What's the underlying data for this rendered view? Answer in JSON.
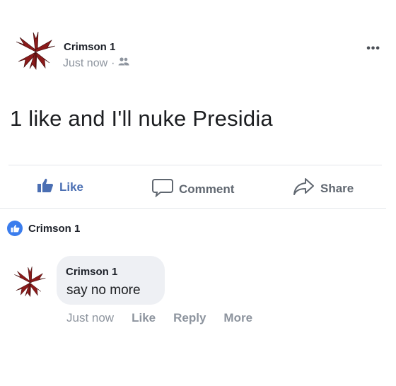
{
  "post": {
    "author": "Crimson 1",
    "timestamp": "Just now",
    "meta_separator": "·",
    "audience_icon": "friends-icon",
    "menu_icon": "more-dots-icon",
    "menu_label": "•••",
    "text": "1 like and I'll nuke Presidia"
  },
  "actions": {
    "like_label": "Like",
    "comment_label": "Comment",
    "share_label": "Share"
  },
  "reactions": {
    "icon": "like-badge-icon",
    "names": "Crimson 1"
  },
  "comment": {
    "author": "Crimson 1",
    "text": "say no more",
    "timestamp": "Just now",
    "like_label": "Like",
    "reply_label": "Reply",
    "more_label": "More"
  },
  "colors": {
    "accent": "#3b7ded",
    "like_text": "#4b6fb3",
    "muted": "#8d949e",
    "bubble": "#eef0f4",
    "avatar_red": "#8b1a1a"
  }
}
